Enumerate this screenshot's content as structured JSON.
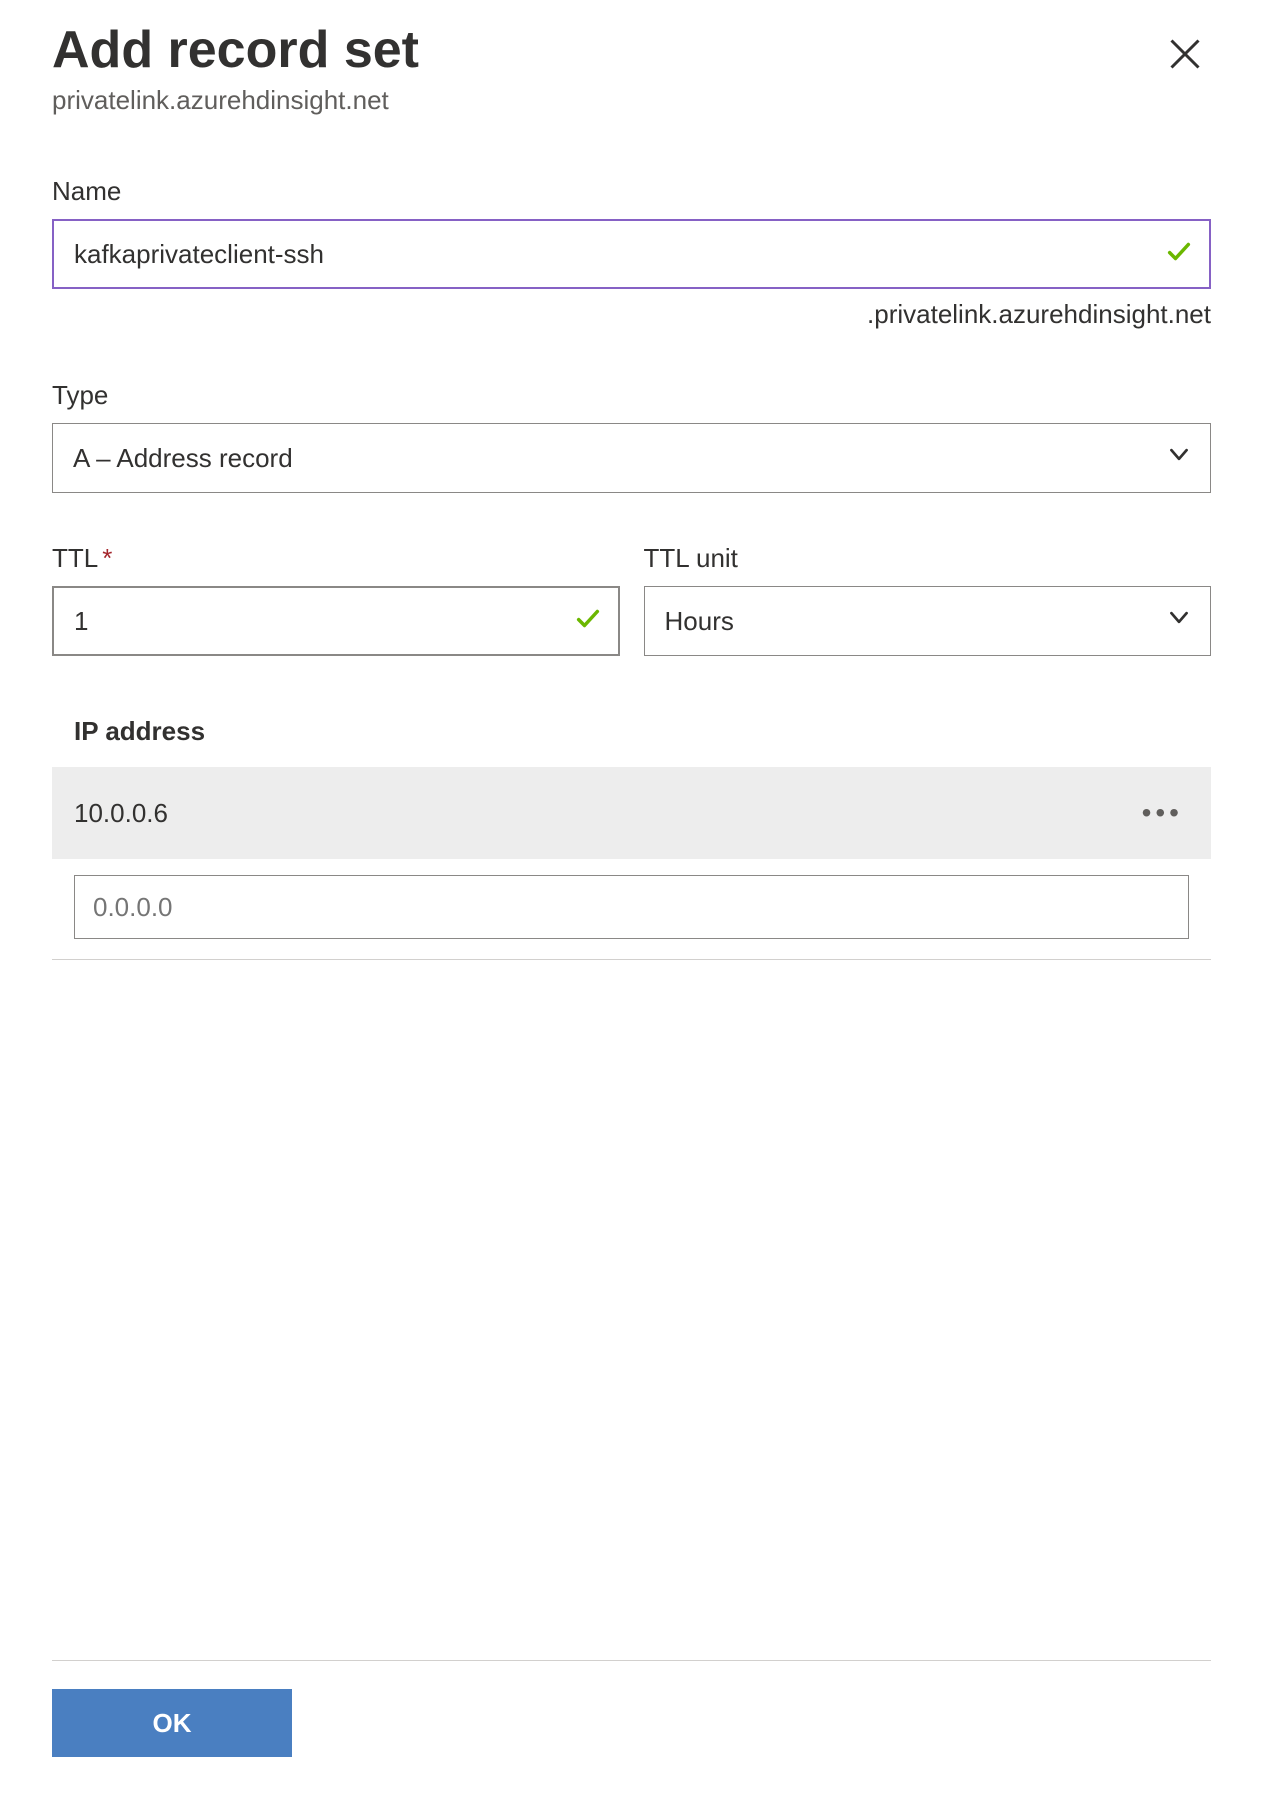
{
  "header": {
    "title": "Add record set",
    "subtitle": "privatelink.azurehdinsight.net"
  },
  "form": {
    "name": {
      "label": "Name",
      "value": "kafkaprivateclient-ssh",
      "suffix": ".privatelink.azurehdinsight.net"
    },
    "type": {
      "label": "Type",
      "value": "A – Address record"
    },
    "ttl": {
      "label": "TTL",
      "value": "1"
    },
    "ttl_unit": {
      "label": "TTL unit",
      "value": "Hours"
    },
    "ip": {
      "label": "IP address",
      "entries": [
        "10.0.0.6"
      ],
      "placeholder": "0.0.0.0"
    }
  },
  "footer": {
    "ok_label": "OK"
  }
}
